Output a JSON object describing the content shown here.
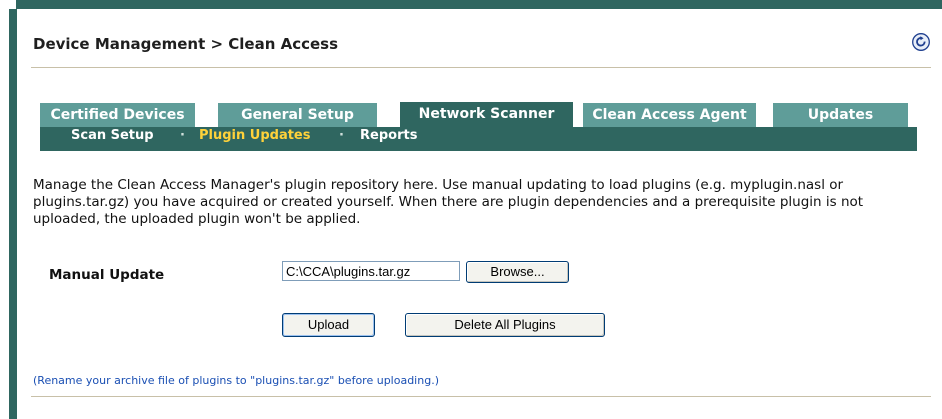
{
  "header": {
    "title": "Device Management > Clean Access"
  },
  "tabs": [
    {
      "label": "Certified Devices",
      "active": false
    },
    {
      "label": "General Setup",
      "active": false
    },
    {
      "label": "Network Scanner",
      "active": true
    },
    {
      "label": "Clean Access Agent",
      "active": false
    },
    {
      "label": "Updates",
      "active": false
    }
  ],
  "subnav": {
    "items": [
      {
        "label": "Scan Setup",
        "active": false
      },
      {
        "label": "Plugin Updates",
        "active": true
      },
      {
        "label": "Reports",
        "active": false
      }
    ],
    "separator": "·"
  },
  "description": "Manage the Clean Access Manager's plugin repository here. Use manual updating to load plugins (e.g. myplugin.nasl or plugins.tar.gz) you have acquired or created yourself. When there are plugin dependencies and a prerequisite plugin is not uploaded, the uploaded plugin won't be applied.",
  "form": {
    "manual_update_label": "Manual Update",
    "file_value": "C:\\CCA\\plugins.tar.gz",
    "browse_label": "Browse...",
    "upload_label": "Upload",
    "delete_label": "Delete All Plugins"
  },
  "note": "(Rename your archive file of plugins to \"plugins.tar.gz\" before uploading.)",
  "colors": {
    "tab_inactive": "#5f9d99",
    "tab_active": "#2f6660",
    "subnav_active": "#ffd23a",
    "note_link": "#1a4fb3"
  },
  "icons": {
    "refresh": "refresh-icon"
  }
}
